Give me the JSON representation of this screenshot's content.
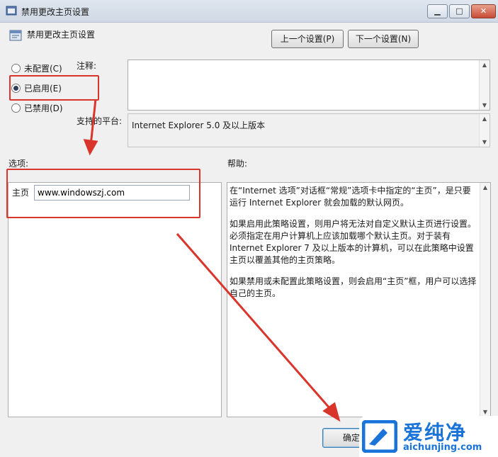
{
  "window": {
    "title": "禁用更改主页设置",
    "min": "▁",
    "max": "□",
    "close": "✕"
  },
  "header": {
    "title": "禁用更改主页设置",
    "prev": "上一个设置(P)",
    "next": "下一个设置(N)"
  },
  "radios": [
    {
      "label": "未配置(C)",
      "checked": false
    },
    {
      "label": "已启用(E)",
      "checked": true
    },
    {
      "label": "已禁用(D)",
      "checked": false
    }
  ],
  "comment_label": "注释:",
  "platform_label": "支持的平台:",
  "platform_value": "Internet Explorer 5.0 及以上版本",
  "options_label": "选项:",
  "help_label": "帮助:",
  "homepage": {
    "label": "主页",
    "value": "www.windowszj.com"
  },
  "help": [
    "在“Internet 选项”对话框“常规”选项卡中指定的“主页”，是只要运行 Internet Explorer 就会加载的默认网页。",
    "如果启用此策略设置，则用户将无法对自定义默认主页进行设置。必须指定在用户计算机上应该加载哪个默认主页。对于装有 Internet Explorer 7 及以上版本的计算机，可以在此策略中设置主页以覆盖其他的主页策略。",
    "如果禁用或未配置此策略设置，则会启用“主页”框，用户可以选择自己的主页。"
  ],
  "ok_label": "确定",
  "watermark": {
    "name": "爱纯净",
    "url": "aichunjing.com"
  },
  "colors": {
    "annotation_red": "#d9352b",
    "logo_blue": "#1a73d9"
  }
}
